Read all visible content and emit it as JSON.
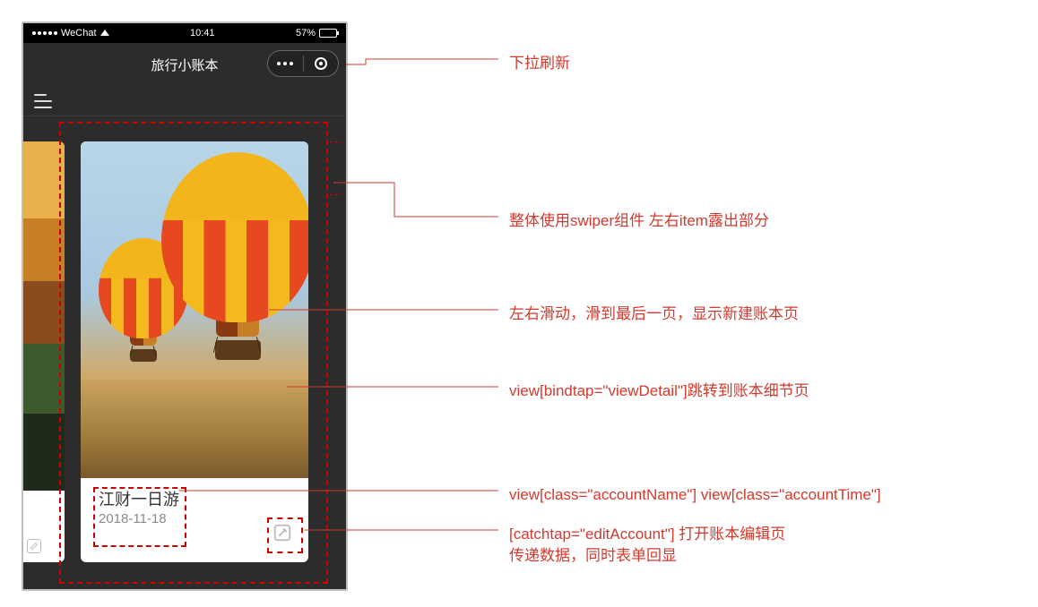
{
  "statusbar": {
    "carrier": "WeChat",
    "time": "10:41",
    "battery_text": "57%"
  },
  "navbar": {
    "title": "旅行小账本"
  },
  "card": {
    "accountName": "江财一日游",
    "accountTime": "2018-11-18"
  },
  "annotations": {
    "pulldown": "下拉刷新",
    "swiper": "整体使用swiper组件 左右item露出部分",
    "slide": "左右滑动，滑到最后一页，显示新建账本页",
    "viewDetail": "view[bindtap=\"viewDetail\"]跳转到账本细节页",
    "nameTime": "view[class=\"accountName\"]  view[class=\"accountTime\"]",
    "editAccount_line1": "[catchtap=\"editAccount\"] 打开账本编辑页",
    "editAccount_line2": "传递数据，同时表单回显"
  }
}
